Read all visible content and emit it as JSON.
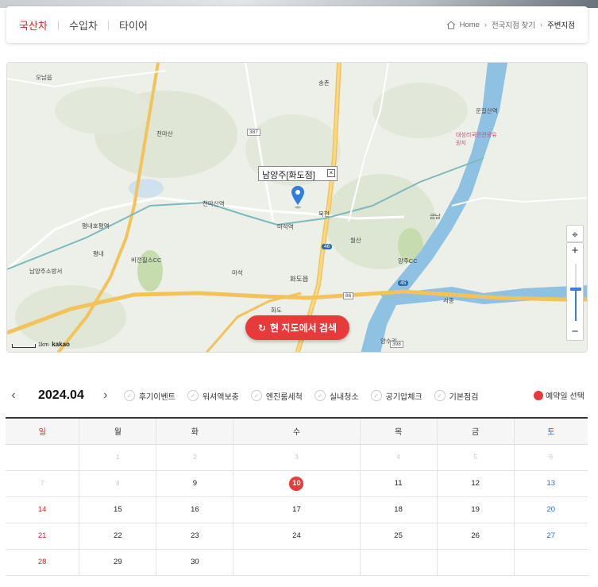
{
  "header": {
    "tabs": [
      {
        "label": "국산차",
        "active": true
      },
      {
        "label": "수입차",
        "active": false
      },
      {
        "label": "타이어",
        "active": false
      }
    ],
    "breadcrumb": [
      "Home",
      "전국지점 찾기",
      "주변지점"
    ]
  },
  "map": {
    "popup_label": "남양주[화도점]",
    "search_button": "현 지도에서 검색",
    "scale_label": "1km",
    "provider": "kakao",
    "places": [
      "오남읍",
      "천마산",
      "천마산역",
      "평내호평역",
      "평내",
      "남양주소방서",
      "비전힐스CC",
      "마석역",
      "마석",
      "화도읍",
      "화도",
      "월산",
      "양주CC",
      "묵현",
      "송촌",
      "운길산역",
      "대성리국민관광유원지",
      "금남",
      "서종",
      "양수리"
    ],
    "road_numbers": [
      "387",
      "46",
      "45",
      "86",
      "398"
    ]
  },
  "calendar": {
    "month": "2024.04",
    "filters": [
      "후기이벤트",
      "워셔액보충",
      "엔진룸세척",
      "실내청소",
      "공기압체크",
      "기본점검"
    ],
    "legend": "예약일 선택",
    "weekdays": [
      "일",
      "월",
      "화",
      "수",
      "목",
      "금",
      "토"
    ],
    "weeks": [
      [
        "",
        "1",
        "2",
        "3",
        "4",
        "5",
        "6"
      ],
      [
        "7",
        "8",
        "9",
        "10",
        "11",
        "12",
        "13"
      ],
      [
        "14",
        "15",
        "16",
        "17",
        "18",
        "19",
        "20"
      ],
      [
        "21",
        "22",
        "23",
        "24",
        "25",
        "26",
        "27"
      ],
      [
        "28",
        "29",
        "30",
        "",
        "",
        "",
        ""
      ]
    ],
    "selected_day": "10",
    "disabled_days": [
      "1",
      "2",
      "3",
      "4",
      "5",
      "6",
      "7",
      "8"
    ]
  },
  "colors": {
    "accent": "#e83a3a",
    "sunday": "#e02020",
    "saturday": "#2a6fc9"
  }
}
